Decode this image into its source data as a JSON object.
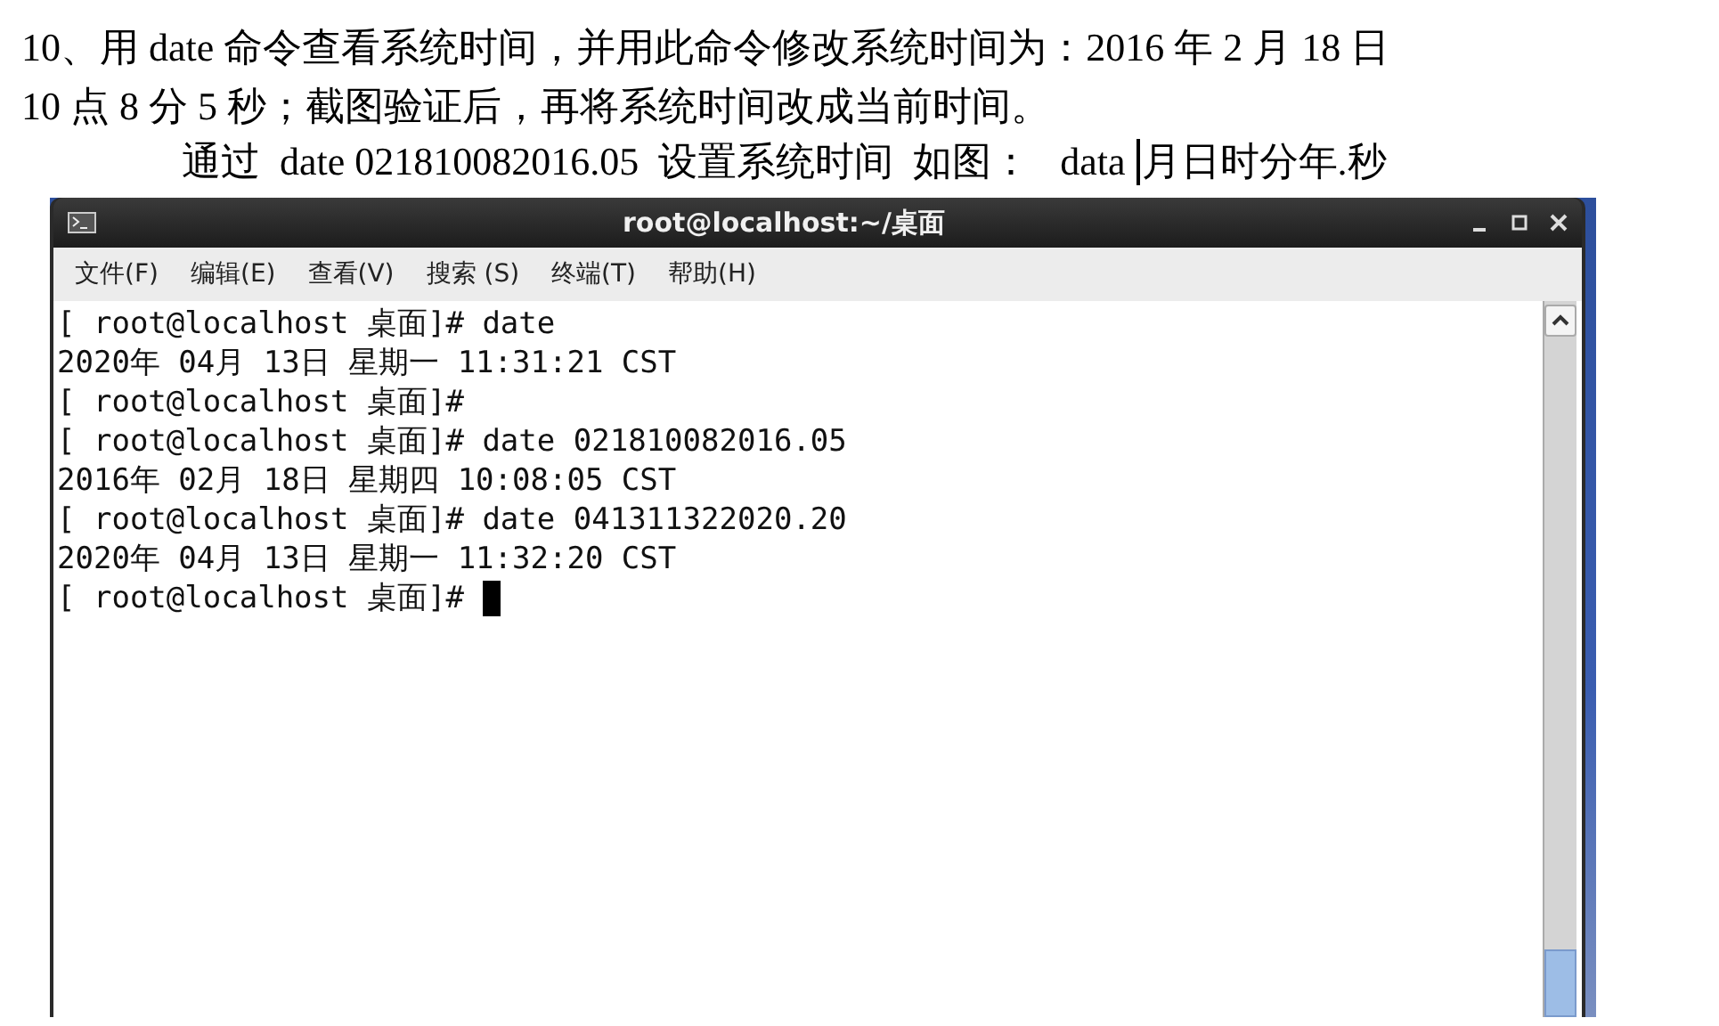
{
  "document": {
    "lines": [
      "10、用 date 命令查看系统时间，并用此命令修改系统时间为：2016 年 2 月 18 日",
      "10 点 8 分 5 秒；截图验证后，再将系统时间改成当前时间。"
    ],
    "note": {
      "before_caret": "通过  date 021810082016.05  设置系统时间  如图：   data ",
      "after_caret": "月日时分年.秒",
      "caret": true
    }
  },
  "terminal": {
    "title": "root@localhost:~/桌面",
    "menu": [
      "文件(F)",
      "编辑(E)",
      "查看(V)",
      "搜索 (S)",
      "终端(T)",
      "帮助(H)"
    ],
    "lines": [
      "[ root@localhost 桌面]# date",
      "2020年 04月 13日 星期一 11:31:21 CST",
      "[ root@localhost 桌面]#",
      "[ root@localhost 桌面]# date 021810082016.05",
      "2016年 02月 18日 星期四 10:08:05 CST",
      "[ root@localhost 桌面]# date 041311322020.20",
      "2020年 04月 13日 星期一 11:32:20 CST",
      "[ root@localhost 桌面]# "
    ],
    "cursor": true
  }
}
